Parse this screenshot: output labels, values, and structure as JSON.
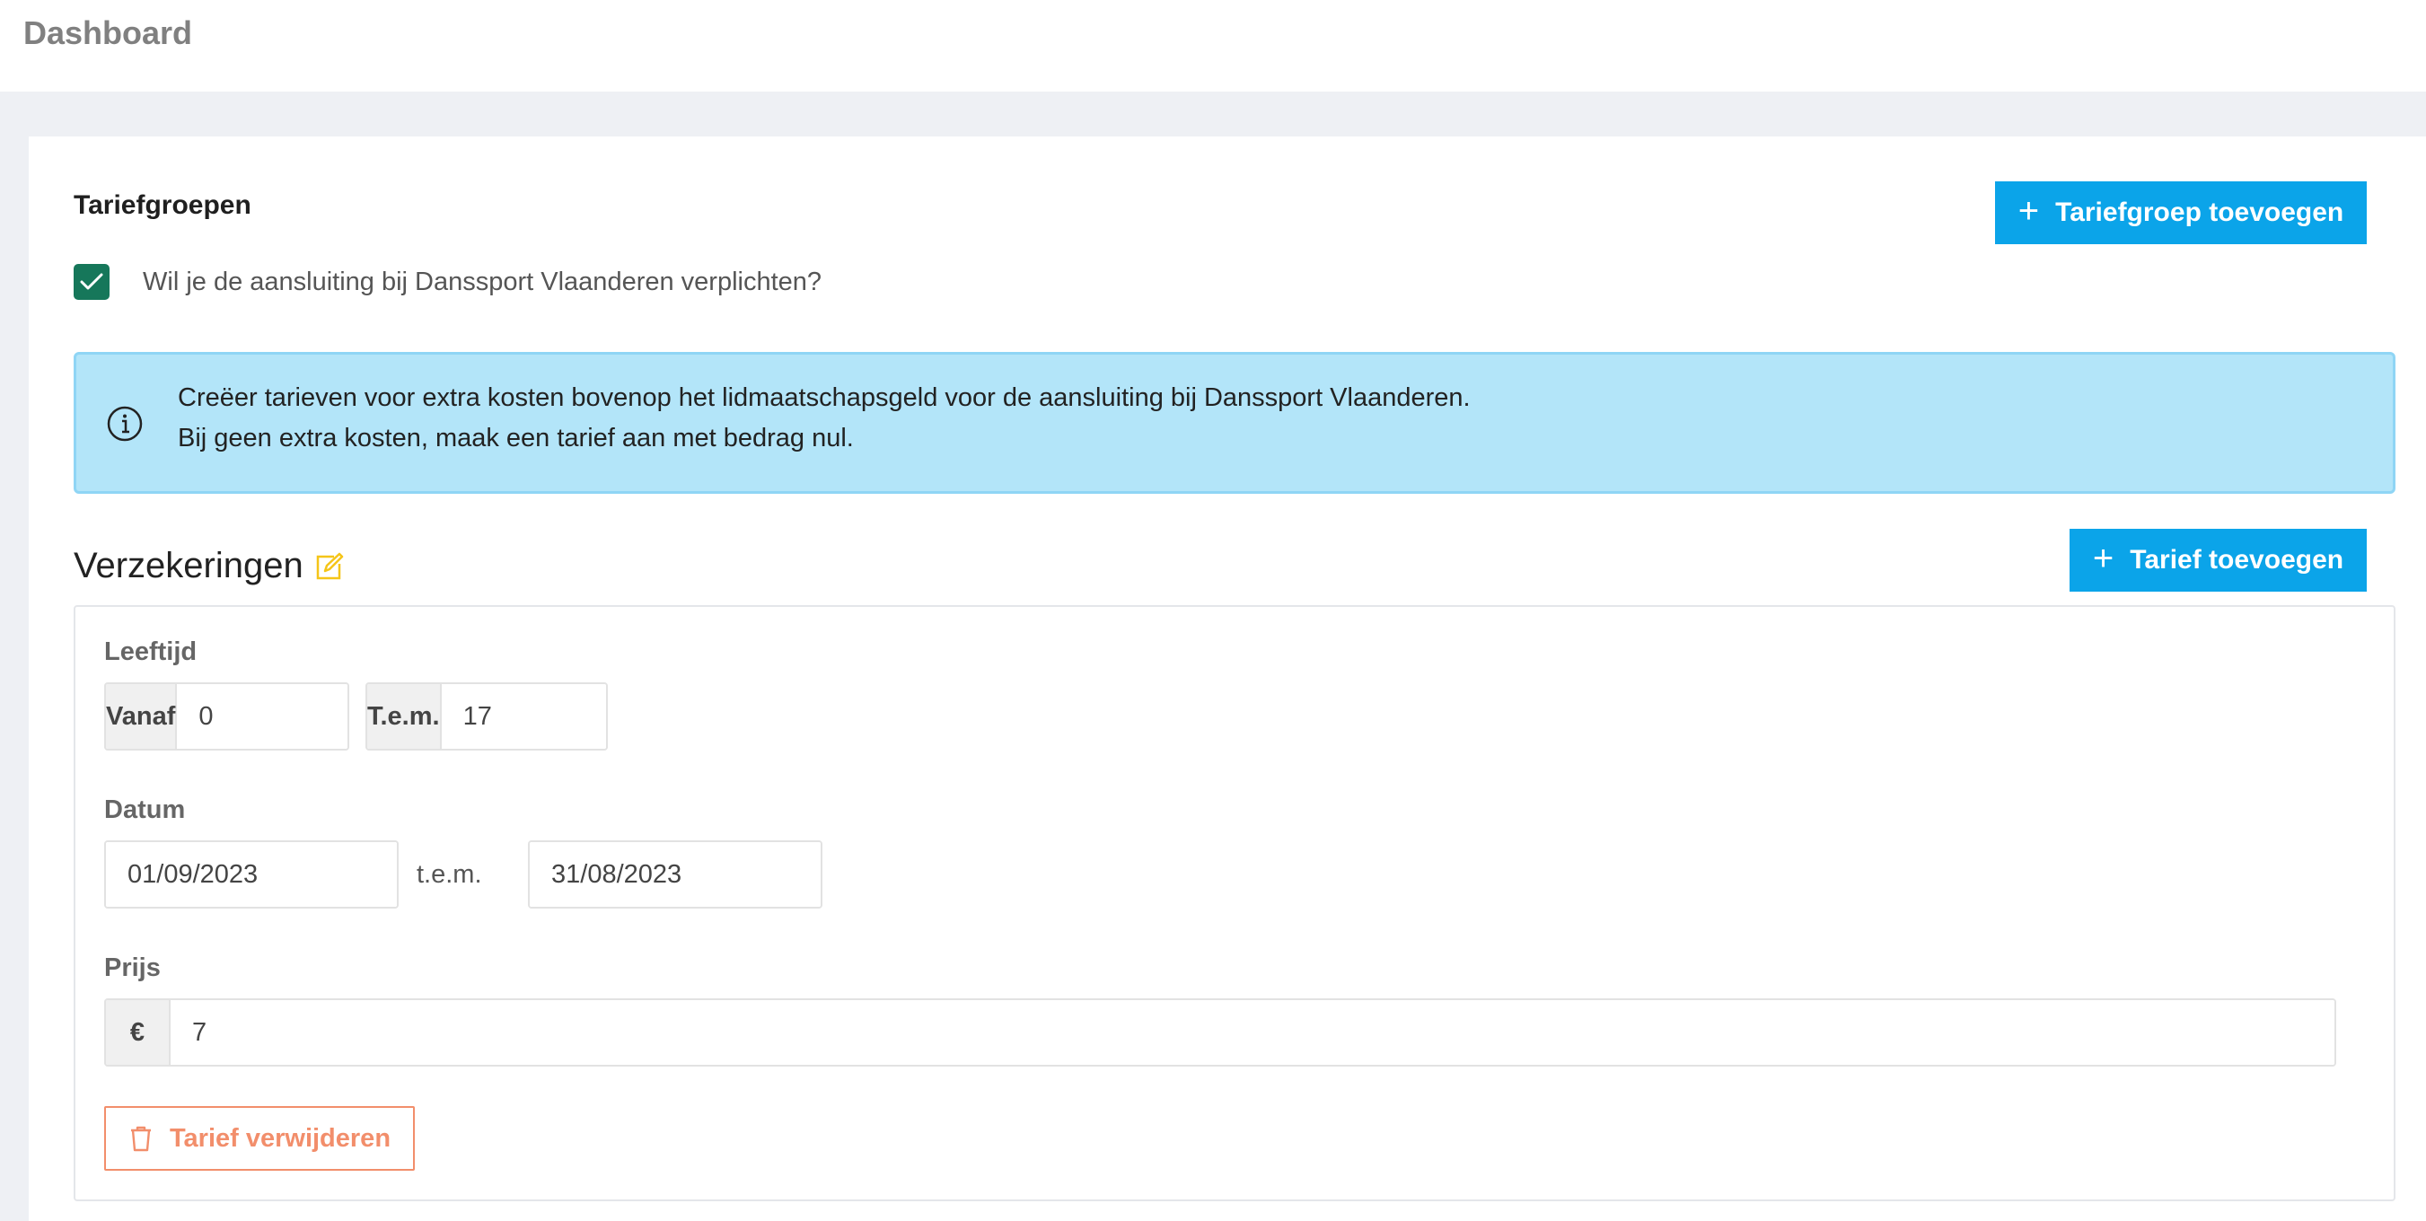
{
  "header": {
    "title": "Dashboard"
  },
  "tariff_groups": {
    "title": "Tariefgroepen",
    "add_group_label": "Tariefgroep toevoegen",
    "checkbox": {
      "checked": true,
      "label": "Wil je de aansluiting bij Danssport Vlaanderen verplichten?"
    },
    "info": {
      "line1": "Creëer tarieven voor extra kosten bovenop het lidmaatschapsgeld voor de aansluiting bij Danssport Vlaanderen.",
      "line2": "Bij geen extra kosten, maak een tarief aan met bedrag nul."
    }
  },
  "group": {
    "title": "Verzekeringen",
    "add_tariff_label": "Tarief toevoegen",
    "tariff": {
      "age": {
        "label": "Leeftijd",
        "from_label": "Vanaf",
        "from_value": "0",
        "to_label": "T.e.m.",
        "to_value": "17"
      },
      "date": {
        "label": "Datum",
        "from_value": "01/09/2023",
        "separator": "t.e.m.",
        "to_value": "31/08/2023"
      },
      "price": {
        "label": "Prijs",
        "currency": "€",
        "value": "7"
      },
      "delete_label": "Tarief verwijderen"
    }
  },
  "colors": {
    "primary": "#0ba4e9",
    "checkbox": "#16775a",
    "info_bg": "#b3e5f9",
    "danger": "#f28e6b",
    "edit_icon": "#f5c518"
  }
}
